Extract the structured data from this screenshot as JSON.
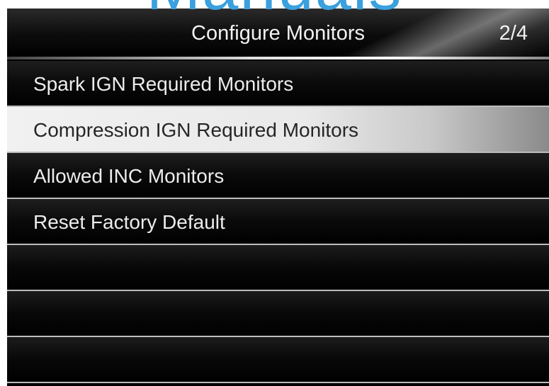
{
  "watermark": {
    "text": "Manuals"
  },
  "header": {
    "title": "Configure Monitors",
    "page": "2/4"
  },
  "menu": {
    "selected_index": 1,
    "items": [
      {
        "label": "Spark IGN Required Monitors"
      },
      {
        "label": "Compression IGN Required Monitors"
      },
      {
        "label": "Allowed INC Monitors"
      },
      {
        "label": "Reset Factory Default"
      },
      {
        "label": ""
      },
      {
        "label": ""
      },
      {
        "label": ""
      }
    ]
  },
  "colors": {
    "watermark": "#3aa0de",
    "selected_row": "#e9e9e9",
    "row_text": "#ececec",
    "selected_text": "#262626",
    "background": "#000000"
  }
}
